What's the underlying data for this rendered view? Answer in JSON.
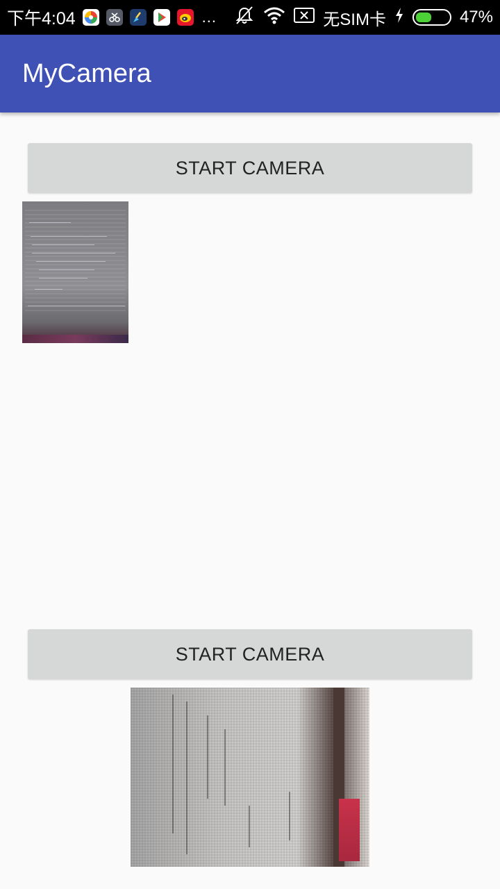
{
  "status_bar": {
    "time": "下午4:04",
    "notifications": [
      {
        "icon": "pinwheel-app-icon",
        "color": "#ffffff"
      },
      {
        "icon": "scissors-app-icon",
        "color": "#555a66"
      },
      {
        "icon": "broom-app-icon",
        "color": "#1f3c6e"
      },
      {
        "icon": "play-store-icon",
        "color": "#ffffff"
      },
      {
        "icon": "weibo-icon",
        "color": "#e6162d"
      }
    ],
    "more": "...",
    "carrier": "无SIM卡",
    "battery_percent": "47%",
    "battery_level": 0.47
  },
  "toolbar": {
    "title": "MyCamera",
    "color": "#3f51b5"
  },
  "buttons": {
    "start_camera_1": "START CAMERA",
    "start_camera_2": "START CAMERA"
  }
}
